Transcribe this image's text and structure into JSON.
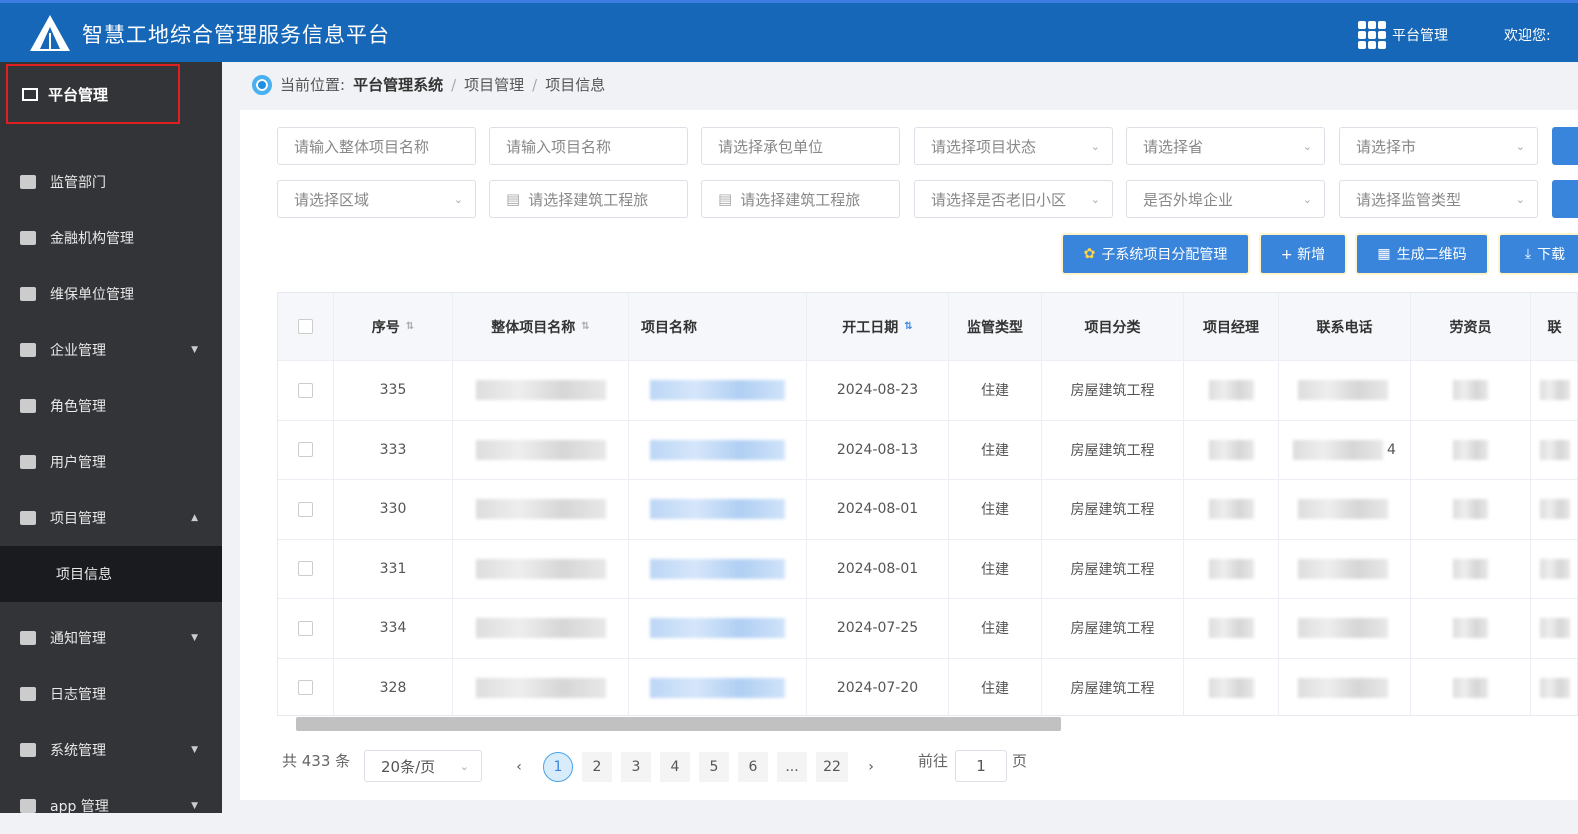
{
  "header": {
    "title": "智慧工地综合管理服务信息平台",
    "menu": "平台管理",
    "welcome": "欢迎您:"
  },
  "sidebar": {
    "head": "平台管理",
    "items": [
      {
        "label": "监管部门",
        "caret": ""
      },
      {
        "label": "金融机构管理",
        "caret": ""
      },
      {
        "label": "维保单位管理",
        "caret": ""
      },
      {
        "label": "企业管理",
        "caret": "▼"
      },
      {
        "label": "角色管理",
        "caret": ""
      },
      {
        "label": "用户管理",
        "caret": ""
      },
      {
        "label": "项目管理",
        "caret": "▲"
      },
      {
        "label": "项目信息",
        "caret": ""
      },
      {
        "label": "通知管理",
        "caret": "▼"
      },
      {
        "label": "日志管理",
        "caret": ""
      },
      {
        "label": "系统管理",
        "caret": "▼"
      },
      {
        "label": "app 管理",
        "caret": "▼"
      }
    ]
  },
  "breadcrumb": {
    "prefix": "当前位置:",
    "items": [
      "平台管理系统",
      "/",
      "项目管理",
      "/",
      "项目信息"
    ]
  },
  "filters": [
    "请输入整体项目名称",
    "请输入项目名称",
    "请选择承包单位",
    "请选择项目状态",
    "请选择省",
    "请选择市",
    "请选择区域",
    "请选择建筑工程旅",
    "请选择建筑工程旅",
    "请选择是否老旧小区",
    "是否外埠企业",
    "请选择监管类型"
  ],
  "actions": [
    "子系统项目分配管理",
    "+ 新增",
    "生成二维码",
    "下载"
  ],
  "table": {
    "columns": [
      "序号",
      "整体项目名称",
      "项目名称",
      "开工日期",
      "监管类型",
      "项目分类",
      "项目经理",
      "联系电话",
      "劳资员",
      "联"
    ],
    "rows": [
      {
        "id": "335",
        "date": "2024-08-23",
        "type": "住建",
        "cat": "房屋建筑工程",
        "phone": ""
      },
      {
        "id": "333",
        "date": "2024-08-13",
        "type": "住建",
        "cat": "房屋建筑工程",
        "phone": "4"
      },
      {
        "id": "330",
        "date": "2024-08-01",
        "type": "住建",
        "cat": "房屋建筑工程",
        "phone": ""
      },
      {
        "id": "331",
        "date": "2024-08-01",
        "type": "住建",
        "cat": "房屋建筑工程",
        "phone": ""
      },
      {
        "id": "334",
        "date": "2024-07-25",
        "type": "住建",
        "cat": "房屋建筑工程",
        "phone": ""
      },
      {
        "id": "328",
        "date": "2024-07-20",
        "type": "住建",
        "cat": "房屋建筑工程",
        "phone": ""
      }
    ]
  },
  "pagination": {
    "total": "共 433 条",
    "page_size": "20条/页",
    "pages": [
      "1",
      "2",
      "3",
      "4",
      "5",
      "6",
      "...",
      "22"
    ],
    "current": "1",
    "goto_label": "前往",
    "goto_value": "1",
    "page_suffix": "页"
  }
}
